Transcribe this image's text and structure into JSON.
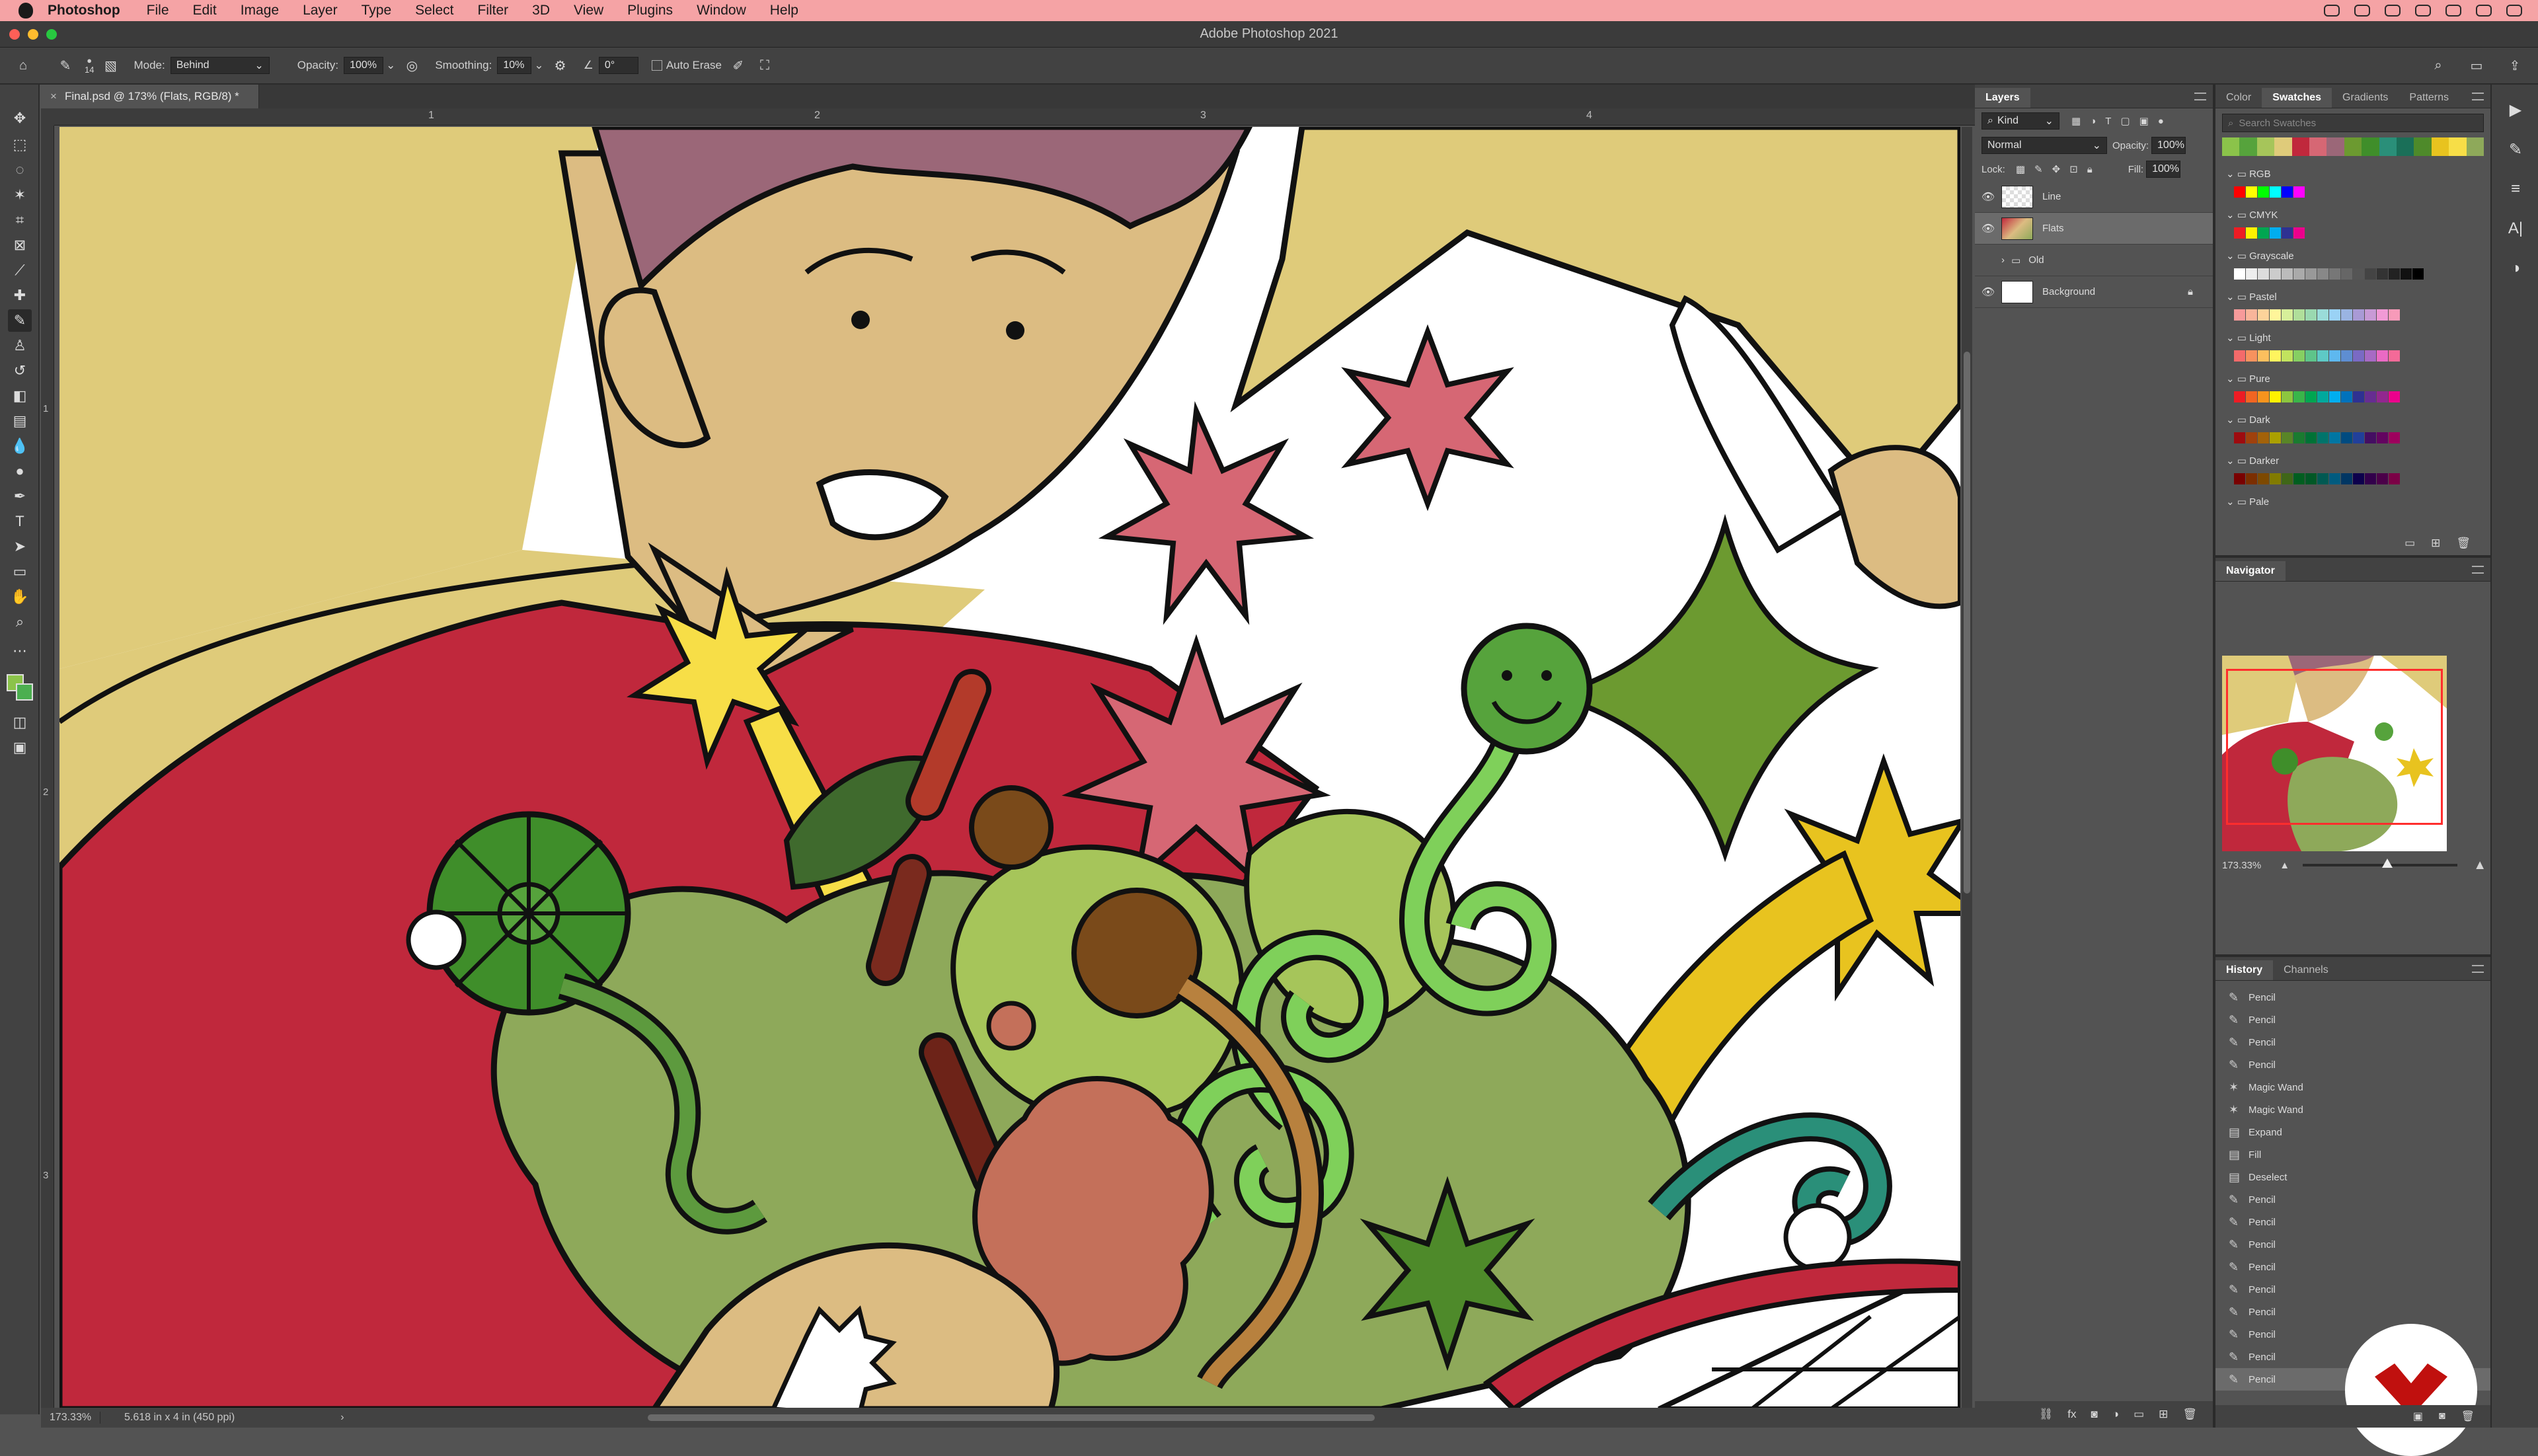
{
  "menubar": {
    "app": "Photoshop",
    "items": [
      "File",
      "Edit",
      "Image",
      "Layer",
      "Type",
      "Select",
      "Filter",
      "3D",
      "View",
      "Plugins",
      "Window",
      "Help"
    ]
  },
  "window": {
    "title": "Adobe Photoshop 2021"
  },
  "options": {
    "brush_size": "14",
    "mode_label": "Mode:",
    "mode_value": "Behind",
    "opacity_label": "Opacity:",
    "opacity_value": "100%",
    "smoothing_label": "Smoothing:",
    "smoothing_value": "10%",
    "angle_value": "0°",
    "auto_erase": "Auto Erase"
  },
  "document": {
    "tab": "Final.psd @ 173% (Flats, RGB/8) *",
    "ruler_marks": [
      "1",
      "2",
      "3",
      "4"
    ],
    "vruler_marks": [
      "1",
      "2",
      "3"
    ],
    "zoom": "173.33%",
    "size_info": "5.618 in x 4 in (450 ppi)"
  },
  "layers": {
    "tab": "Layers",
    "kind": "Kind",
    "blend": "Normal",
    "opacity_label": "Opacity:",
    "opacity_value": "100%",
    "lock_label": "Lock:",
    "fill_label": "Fill:",
    "fill_value": "100%",
    "items": [
      {
        "name": "Line"
      },
      {
        "name": "Flats"
      },
      {
        "name": "Old"
      },
      {
        "name": "Background"
      }
    ]
  },
  "swatches": {
    "tabs": [
      "Color",
      "Swatches",
      "Gradients",
      "Patterns"
    ],
    "search_placeholder": "Search Swatches",
    "groups": [
      "RGB",
      "CMYK",
      "Grayscale",
      "Pastel",
      "Light",
      "Pure",
      "Dark",
      "Darker",
      "Pale"
    ]
  },
  "navigator": {
    "tab": "Navigator",
    "zoom": "173.33%"
  },
  "history": {
    "tabs": [
      "History",
      "Channels"
    ],
    "items": [
      "Pencil",
      "Pencil",
      "Pencil",
      "Pencil",
      "Magic Wand",
      "Magic Wand",
      "Expand",
      "Fill",
      "Deselect",
      "Pencil",
      "Pencil",
      "Pencil",
      "Pencil",
      "Pencil",
      "Pencil",
      "Pencil",
      "Pencil",
      "Pencil"
    ]
  },
  "colors": {
    "menubar": "#f5a3a5",
    "foreground": "#8bc34a",
    "accent_red": "#c0283c"
  }
}
